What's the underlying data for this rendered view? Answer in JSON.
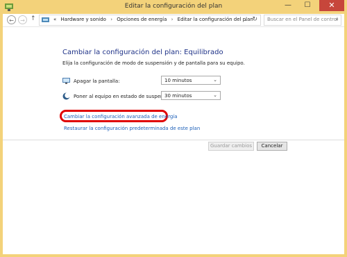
{
  "window": {
    "title": "Editar la configuración del plan",
    "buttons": {
      "minimize": "—",
      "maximize": "☐",
      "close": "✕"
    }
  },
  "nav": {
    "back_icon": "arrow-left-icon",
    "forward_icon": "arrow-right-icon",
    "up_icon": "arrow-up-icon"
  },
  "address": {
    "prefix": "«",
    "crumbs": [
      "Hardware y sonido",
      "Opciones de energía",
      "Editar la configuración del plan"
    ],
    "separator": "›"
  },
  "search": {
    "placeholder": "Buscar en el Panel de control"
  },
  "main": {
    "heading": "Cambiar la configuración del plan: Equilibrado",
    "subtitle": "Elija la configuración de modo de suspensión y de pantalla para su equipo.",
    "settings": [
      {
        "label": "Apagar la pantalla:",
        "value": "10 minutos",
        "icon": "monitor-icon"
      },
      {
        "label": "Poner al equipo en estado de suspensión:",
        "value": "30 minutos",
        "icon": "moon-icon"
      }
    ],
    "links": {
      "advanced": "Cambiar la configuración avanzada de energía",
      "restore": "Restaurar la configuración predeterminada de este plan"
    }
  },
  "footer": {
    "save": "Guardar cambios",
    "cancel": "Cancelar"
  },
  "colors": {
    "title_bar": "#f3d27a",
    "heading": "#1e3287",
    "link": "#1c5fb8",
    "highlight": "#e00000",
    "close": "#c7463b"
  }
}
